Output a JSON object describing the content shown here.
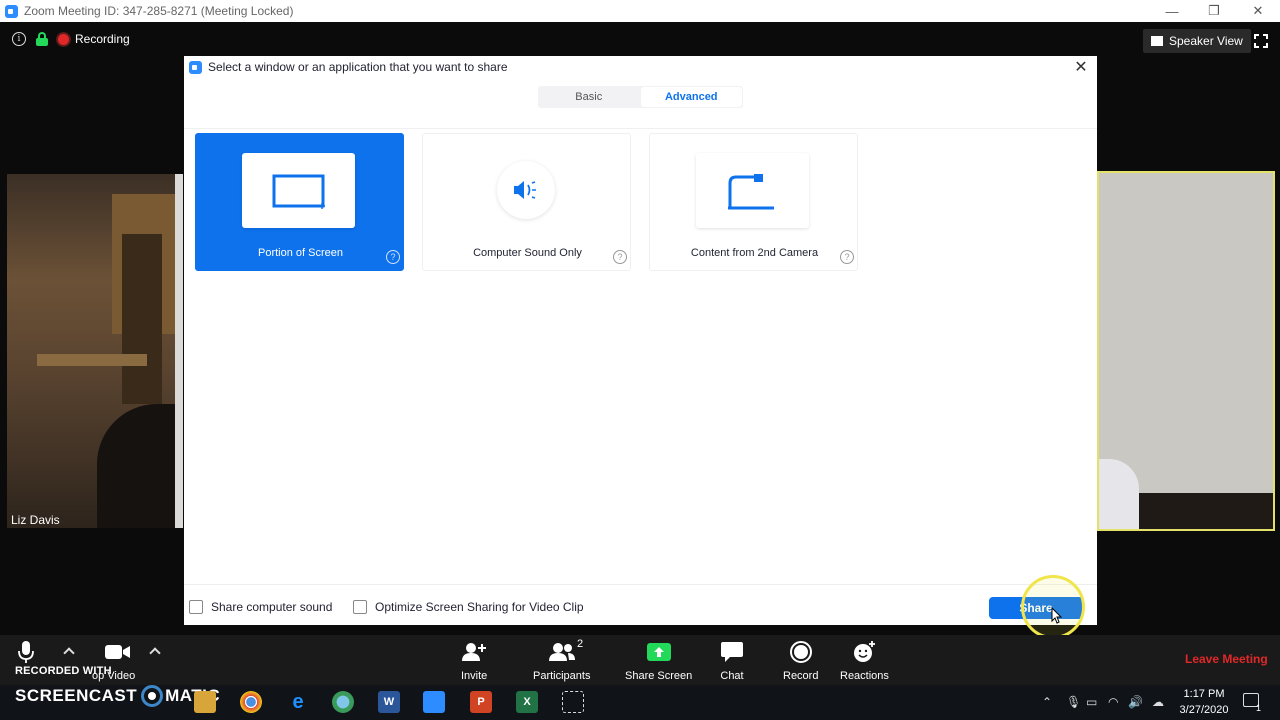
{
  "window": {
    "title": "Zoom Meeting ID: 347-285-8271  (Meeting Locked)",
    "minimize": "—",
    "restore": "❐",
    "close": "✕"
  },
  "meeting_bar": {
    "recording_label": "Recording",
    "speaker_view_label": "Speaker View"
  },
  "participants_video": {
    "left_name": "Liz Davis"
  },
  "share_dialog": {
    "title": "Select a window or an application that you want to share",
    "tabs": [
      {
        "label": "Basic",
        "active": false
      },
      {
        "label": "Advanced",
        "active": true
      }
    ],
    "options": [
      {
        "label": "Portion of Screen",
        "selected": true,
        "icon": "portion-of-screen-icon"
      },
      {
        "label": "Computer Sound Only",
        "selected": false,
        "icon": "speaker-icon"
      },
      {
        "label": "Content from 2nd Camera",
        "selected": false,
        "icon": "camera-stand-icon"
      }
    ],
    "help_glyph": "?",
    "checkboxes": [
      {
        "label": "Share computer sound",
        "checked": false
      },
      {
        "label": "Optimize Screen Sharing for Video Clip",
        "checked": false
      }
    ],
    "share_button": "Share",
    "close_glyph": "✕"
  },
  "toolbar": {
    "watermark_line": "RECORDED WITH",
    "stop_video_fragment": "op Video",
    "invite": "Invite",
    "participants": "Participants",
    "participants_count": "2",
    "share_screen": "Share Screen",
    "chat": "Chat",
    "record": "Record",
    "reactions": "Reactions",
    "leave": "Leave Meeting"
  },
  "taskbar": {
    "screencast_left": "SCREENCAST",
    "screencast_right": "MATIC",
    "apps": [
      "W",
      "P",
      "X"
    ],
    "time": "1:17 PM",
    "date": "3/27/2020",
    "notif_count": "1"
  },
  "colors": {
    "accent": "#0e72ed",
    "zoom_blue": "#2d8cff",
    "leave_red": "#e02828",
    "share_green": "#23d959",
    "highlight_yellow": "#f0e54a"
  }
}
